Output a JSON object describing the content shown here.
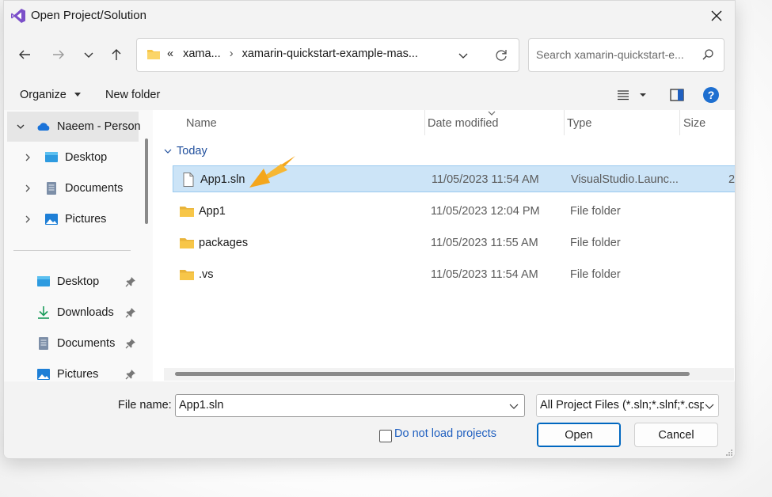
{
  "window": {
    "title": "Open Project/Solution"
  },
  "address": {
    "overflow": "«",
    "crumbs": [
      "xama...",
      "xamarin-quickstart-example-mas..."
    ],
    "separator": "›"
  },
  "search": {
    "placeholder": "Search xamarin-quickstart-e..."
  },
  "toolbar": {
    "organize": "Organize",
    "new_folder": "New folder"
  },
  "nav": {
    "root": "Naeem - Person",
    "tree": [
      "Desktop",
      "Documents",
      "Pictures"
    ],
    "quick": [
      "Desktop",
      "Downloads",
      "Documents",
      "Pictures"
    ]
  },
  "columns": {
    "name": "Name",
    "date": "Date modified",
    "type": "Type",
    "size": "Size"
  },
  "group": {
    "label": "Today"
  },
  "files": [
    {
      "name": "App1.sln",
      "date": "11/05/2023 11:54 AM",
      "type": "VisualStudio.Launc...",
      "size": "2",
      "kind": "file-icon"
    },
    {
      "name": "App1",
      "date": "11/05/2023 12:04 PM",
      "type": "File folder",
      "size": "",
      "kind": "folder-icon"
    },
    {
      "name": "packages",
      "date": "11/05/2023 11:55 AM",
      "type": "File folder",
      "size": "",
      "kind": "folder-icon"
    },
    {
      "name": ".vs",
      "date": "11/05/2023 11:54 AM",
      "type": "File folder",
      "size": "",
      "kind": "folder-icon"
    }
  ],
  "bottom": {
    "file_name_label": "File name:",
    "file_name_value": "App1.sln",
    "filter": "All Project Files (*.sln;*.slnf;*.csp",
    "dont_load": "Do not load projects",
    "open": "Open",
    "cancel": "Cancel"
  },
  "colors": {
    "accent": "#0067c0",
    "selection": "#cce4f7",
    "folder": "#f7c648",
    "annotation_arrow": "#f4a61c"
  }
}
